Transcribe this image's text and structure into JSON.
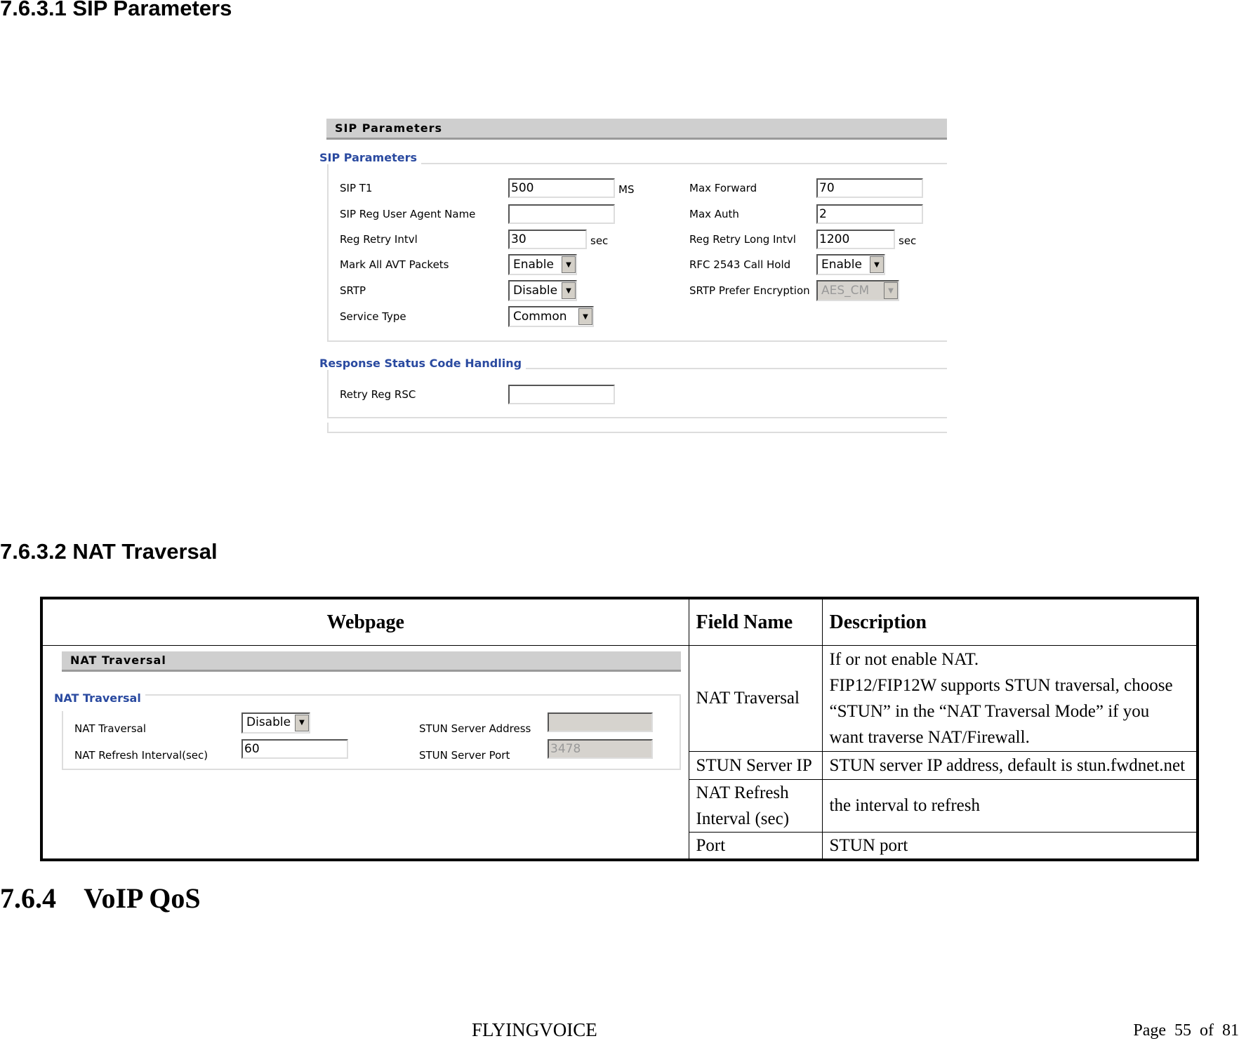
{
  "headings": {
    "s1": "7.6.3.1  SIP Parameters",
    "s2": "7.6.3.2  NAT Traversal",
    "s3": "7.6.4    VoIP QoS"
  },
  "sip_panel": {
    "title": "SIP Parameters",
    "group1": "SIP Parameters",
    "left": [
      {
        "label": "SIP T1",
        "value": "500",
        "unit": "MS",
        "type": "input"
      },
      {
        "label": "SIP Reg User Agent Name",
        "value": "",
        "type": "input"
      },
      {
        "label": "Reg Retry Intvl",
        "value": "30",
        "unit": "sec",
        "type": "input"
      },
      {
        "label": "Mark All AVT Packets",
        "value": "Enable",
        "type": "select"
      },
      {
        "label": "SRTP",
        "value": "Disable",
        "type": "select"
      },
      {
        "label": "Service Type",
        "value": "Common",
        "type": "select"
      }
    ],
    "right": [
      {
        "label": "Max Forward",
        "value": "70",
        "type": "input"
      },
      {
        "label": "Max Auth",
        "value": "2",
        "type": "input"
      },
      {
        "label": "Reg Retry Long Intvl",
        "value": "1200",
        "unit": "sec",
        "type": "input"
      },
      {
        "label": "RFC 2543 Call Hold",
        "value": "Enable",
        "type": "select"
      },
      {
        "label": "SRTP Prefer Encryption",
        "value": "AES_CM",
        "type": "select",
        "disabled": true
      }
    ],
    "group2": "Response Status Code Handling",
    "retry": {
      "label": "Retry Reg RSC",
      "value": ""
    }
  },
  "table": {
    "headers": [
      "Webpage",
      "Field Name",
      "Description"
    ],
    "rows": [
      {
        "field": "NAT Traversal",
        "desc": [
          "If or not enable NAT.",
          "FIP12/FIP12W supports STUN traversal, choose",
          "“STUN” in the “NAT Traversal Mode” if you",
          "want traverse NAT/Firewall."
        ]
      },
      {
        "field": "STUN Server IP",
        "desc": [
          "STUN server IP address, default is stun.fwdnet.net"
        ]
      },
      {
        "field": "NAT Refresh Interval (sec)",
        "desc": [
          "the interval to refresh"
        ]
      },
      {
        "field": "Port",
        "desc": [
          "STUN port"
        ]
      }
    ]
  },
  "nat_panel": {
    "title": "NAT Traversal",
    "group": "NAT Traversal",
    "nat_traversal": {
      "label": "NAT Traversal",
      "value": "Disable"
    },
    "refresh": {
      "label": "NAT Refresh Interval(sec)",
      "value": "60"
    },
    "stun_addr": {
      "label": "STUN Server Address",
      "value": ""
    },
    "stun_port": {
      "label": "STUN Server Port",
      "value": "3478"
    }
  },
  "footer": {
    "brand": "FLYINGVOICE",
    "page": "Page  55  of  81"
  }
}
